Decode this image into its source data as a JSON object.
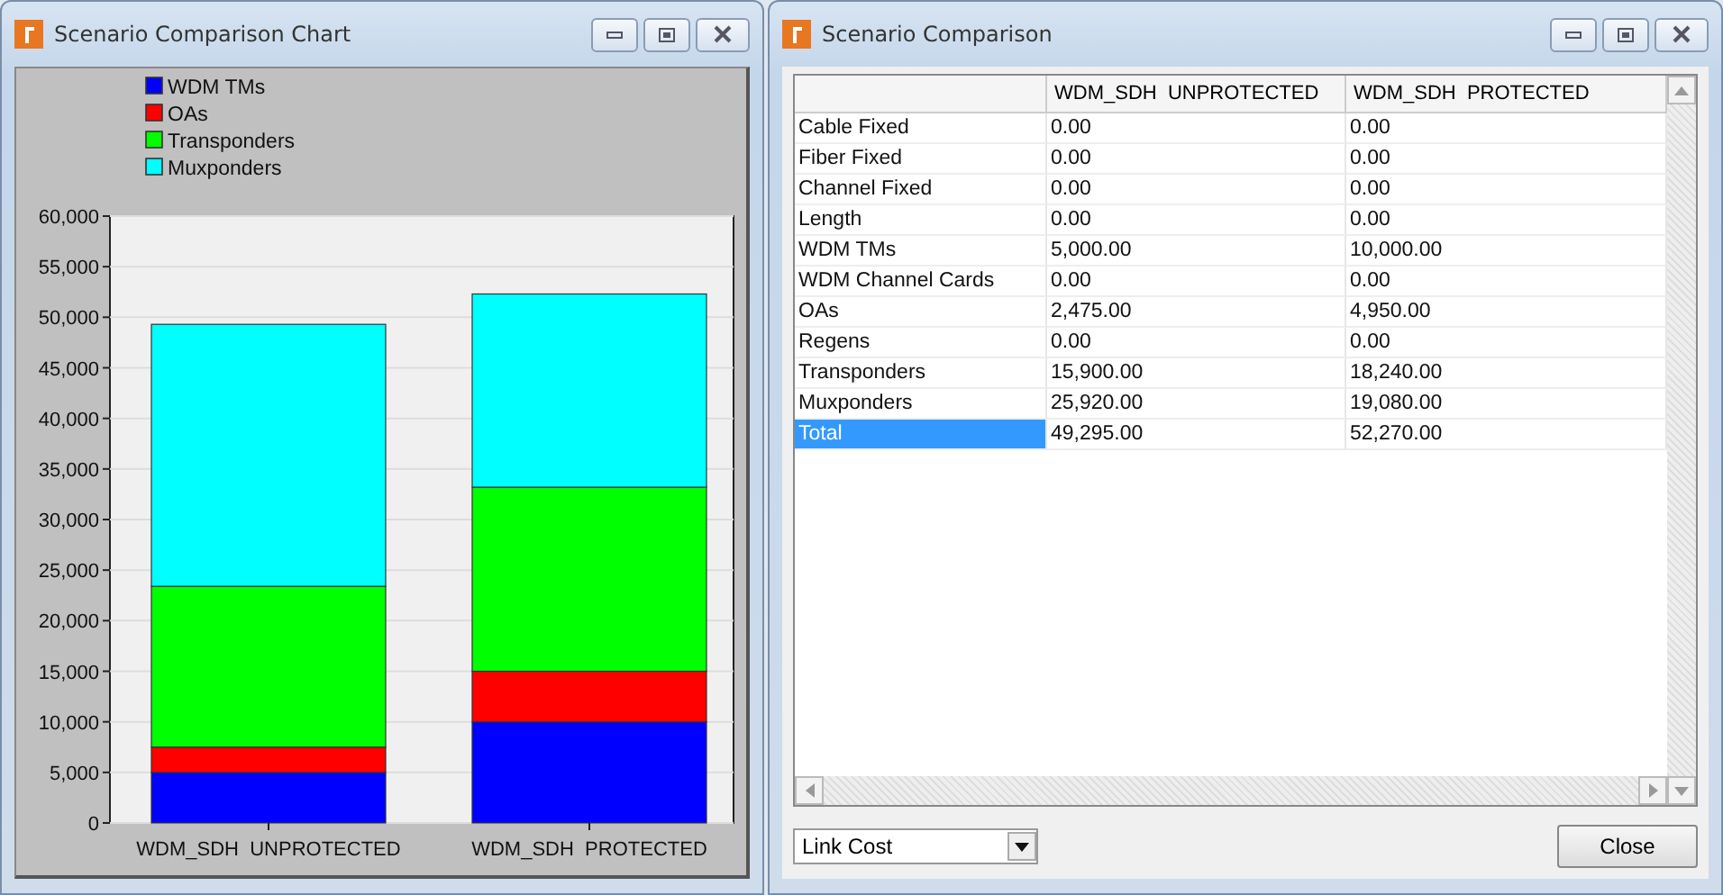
{
  "chart_window": {
    "title": "Scenario Comparison Chart",
    "chart_data": {
      "type": "bar",
      "stacked": true,
      "categories": [
        "WDM_SDH  UNPROTECTED",
        "WDM_SDH  PROTECTED"
      ],
      "series": [
        {
          "name": "WDM TMs",
          "color": "#0000ff",
          "values": [
            5000,
            10000
          ]
        },
        {
          "name": "OAs",
          "color": "#ff0000",
          "values": [
            2500,
            5000
          ]
        },
        {
          "name": "Transponders",
          "color": "#00ff00",
          "values": [
            15900,
            18200
          ]
        },
        {
          "name": "Muxponders",
          "color": "#00ffff",
          "values": [
            25900,
            19100
          ]
        }
      ],
      "grid": true,
      "legend": "top",
      "ylim": [
        0,
        60000
      ],
      "yticks": [
        {
          "value": 0,
          "label": "0"
        },
        {
          "value": 5000,
          "label": "5,000"
        },
        {
          "value": 10000,
          "label": "10,000"
        },
        {
          "value": 15000,
          "label": "15,000"
        },
        {
          "value": 20000,
          "label": "20,000"
        },
        {
          "value": 25000,
          "label": "25,000"
        },
        {
          "value": 30000,
          "label": "30,000"
        },
        {
          "value": 35000,
          "label": "35,000"
        },
        {
          "value": 40000,
          "label": "40,000"
        },
        {
          "value": 45000,
          "label": "45,000"
        },
        {
          "value": 50000,
          "label": "50,000"
        },
        {
          "value": 55000,
          "label": "55,000"
        },
        {
          "value": 60000,
          "label": "60,000"
        }
      ]
    }
  },
  "table_window": {
    "title": "Scenario Comparison",
    "columns": [
      "WDM_SDH  UNPROTECTED",
      "WDM_SDH  PROTECTED"
    ],
    "rows": [
      {
        "label": "Cable Fixed",
        "values": [
          "0.00",
          "0.00"
        ],
        "selected": false
      },
      {
        "label": "Fiber Fixed",
        "values": [
          "0.00",
          "0.00"
        ],
        "selected": false
      },
      {
        "label": "Channel Fixed",
        "values": [
          "0.00",
          "0.00"
        ],
        "selected": false
      },
      {
        "label": "Length",
        "values": [
          "0.00",
          "0.00"
        ],
        "selected": false
      },
      {
        "label": "WDM TMs",
        "values": [
          "5,000.00",
          "10,000.00"
        ],
        "selected": false
      },
      {
        "label": "WDM Channel Cards",
        "values": [
          "0.00",
          "0.00"
        ],
        "selected": false
      },
      {
        "label": "OAs",
        "values": [
          "2,475.00",
          "4,950.00"
        ],
        "selected": false
      },
      {
        "label": "Regens",
        "values": [
          "0.00",
          "0.00"
        ],
        "selected": false
      },
      {
        "label": "Transponders",
        "values": [
          "15,900.00",
          "18,240.00"
        ],
        "selected": false
      },
      {
        "label": "Muxponders",
        "values": [
          "25,920.00",
          "19,080.00"
        ],
        "selected": false
      },
      {
        "label": "Total",
        "values": [
          "49,295.00",
          "52,270.00"
        ],
        "selected": true
      }
    ],
    "dropdown": {
      "value": "Link Cost"
    },
    "close_button": "Close"
  }
}
